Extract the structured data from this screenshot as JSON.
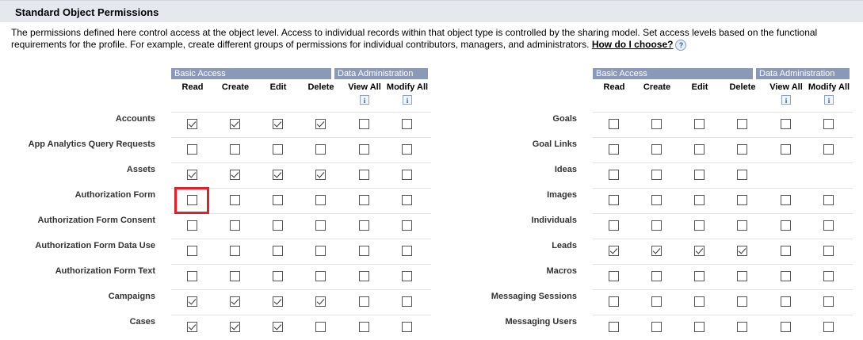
{
  "section": {
    "title": "Standard Object Permissions",
    "description": "The permissions defined here control access at the object level. Access to individual records within that object type is controlled by the sharing model. Set access levels based on the functional requirements for the profile. For example, create different groups of permissions for individual contributors, managers, and administrators.",
    "how_link": "How do I choose?",
    "help_icon": "?"
  },
  "groups": {
    "basic_access": "Basic Access",
    "data_administration": "Data Administration"
  },
  "columns": [
    "Read",
    "Create",
    "Edit",
    "Delete",
    "View All",
    "Modify All"
  ],
  "info_icon": "i",
  "left_objects": [
    {
      "name": "Accounts",
      "perms": [
        true,
        true,
        true,
        true,
        false,
        false
      ]
    },
    {
      "name": "App Analytics Query Requests",
      "perms": [
        false,
        false,
        false,
        false,
        false,
        false
      ]
    },
    {
      "name": "Assets",
      "perms": [
        true,
        true,
        true,
        true,
        false,
        false
      ]
    },
    {
      "name": "Authorization Form",
      "perms": [
        false,
        false,
        false,
        false,
        false,
        false
      ]
    },
    {
      "name": "Authorization Form Consent",
      "perms": [
        false,
        false,
        false,
        false,
        false,
        false
      ]
    },
    {
      "name": "Authorization Form Data Use",
      "perms": [
        false,
        false,
        false,
        false,
        false,
        false
      ]
    },
    {
      "name": "Authorization Form Text",
      "perms": [
        false,
        false,
        false,
        false,
        false,
        false
      ]
    },
    {
      "name": "Campaigns",
      "perms": [
        true,
        true,
        true,
        true,
        false,
        false
      ]
    },
    {
      "name": "Cases",
      "perms": [
        true,
        true,
        true,
        false,
        false,
        false
      ]
    }
  ],
  "right_objects": [
    {
      "name": "Goals",
      "perms": [
        false,
        false,
        false,
        false,
        false,
        false
      ]
    },
    {
      "name": "Goal Links",
      "perms": [
        false,
        false,
        false,
        false,
        false,
        false
      ]
    },
    {
      "name": "Ideas",
      "perms": [
        false,
        false,
        false,
        false,
        null,
        null
      ]
    },
    {
      "name": "Images",
      "perms": [
        false,
        false,
        false,
        false,
        false,
        false
      ]
    },
    {
      "name": "Individuals",
      "perms": [
        false,
        false,
        false,
        false,
        false,
        false
      ]
    },
    {
      "name": "Leads",
      "perms": [
        true,
        true,
        true,
        true,
        false,
        false
      ]
    },
    {
      "name": "Macros",
      "perms": [
        false,
        false,
        false,
        false,
        false,
        false
      ]
    },
    {
      "name": "Messaging Sessions",
      "perms": [
        false,
        false,
        false,
        false,
        false,
        false
      ]
    },
    {
      "name": "Messaging Users",
      "perms": [
        false,
        false,
        false,
        false,
        false,
        false
      ]
    }
  ],
  "colors": {
    "header_bg": "#e6e8ef",
    "group_header_bg": "#8b99b8",
    "highlight": "#e0202a"
  }
}
